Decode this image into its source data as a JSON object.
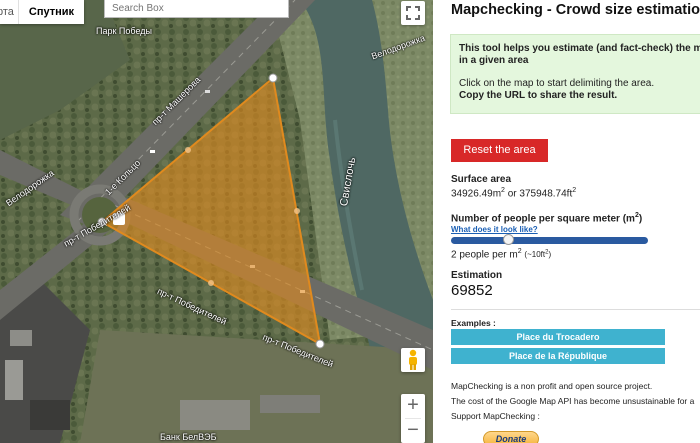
{
  "map": {
    "type_buttons": [
      "рта",
      "Спутник"
    ],
    "search": {
      "placeholder": "Search Box"
    },
    "street_labels": [
      "Парк Победы",
      "пр-т Машерова",
      "1-е Кольцо",
      "Велодорожка",
      "пр-т Победителей",
      "пр-т Победителей",
      "пр-т Победителей",
      "Свислочь",
      "Велодорожка",
      "Банк БелВЭБ"
    ],
    "controls": {
      "fullscreen_icon": "fullscreen-icon",
      "pegman_icon": "pegman-icon",
      "zoom_in": "+",
      "zoom_out": "−"
    }
  },
  "panel": {
    "title": "Mapchecking - Crowd size estimation",
    "info": {
      "line1": "This tool helps you estimate (and fact-check) the ma",
      "line1b": "in a given area",
      "line2": "Click on the map to start delimiting the area.",
      "line3": "Copy the URL to share the result."
    },
    "reset_label": "Reset the area",
    "surface": {
      "label": "Surface area",
      "value_m": "34926.49m",
      "sep": " or ",
      "value_ft": "375948.74ft",
      "sup": "2"
    },
    "density": {
      "label": "Number of people per square meter (m",
      "label_sup": "2",
      "label_end": ")",
      "link": "What does it look like?",
      "slider_fraction": 0.28,
      "value_text": "2 people per m",
      "value_sup": "2",
      "approx": "(~10ft",
      "approx_sup": "2",
      "approx_end": ")"
    },
    "estimation": {
      "label": "Estimation",
      "value": "69852"
    },
    "examples": {
      "label": "Examples :",
      "items": [
        "Place du Trocadero",
        "Place de la République"
      ]
    },
    "footer": {
      "line1": "MapChecking is a non profit and open source project.",
      "line2": "The cost of the Google Map API has become unsustainable for a",
      "line3": "Support MapChecking :",
      "donate": "Donate"
    }
  },
  "colors": {
    "accent_red": "#d82828",
    "example_blue": "#3fb2cf",
    "info_green": "#e4f7dd",
    "polygon_fill": "#e08a1e",
    "slider_blue": "#2a5aa0"
  }
}
